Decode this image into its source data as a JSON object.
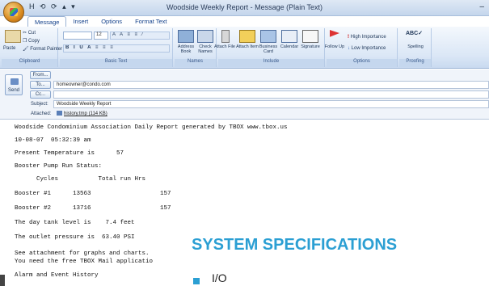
{
  "window": {
    "qat": "H ⟲ ⟳ ▴ ▾",
    "title": "Woodside Weekly Report - Message (Plain Text)",
    "close": "–"
  },
  "tabs": [
    "Message",
    "Insert",
    "Options",
    "Format Text"
  ],
  "ribbon": {
    "clipboard": {
      "cut": "Cut",
      "copy": "Copy",
      "paste": "Paste",
      "format_painter": "Format Painter",
      "label": "Clipboard"
    },
    "basic_text": {
      "font_size": "12",
      "buttons_row1": "A A  ≡ ≡ ⁄",
      "buttons_row2": "B I U  A  ≡ ≡ ≡",
      "label": "Basic Text"
    },
    "names": {
      "address_book": "Address Book",
      "check_names": "Check Names",
      "label": "Names"
    },
    "include": {
      "attach_file": "Attach File",
      "attach_item": "Attach Item",
      "business_card": "Business Card",
      "calendar": "Calendar",
      "signature": "Signature",
      "label": "Include"
    },
    "options": {
      "follow_up": "Follow Up",
      "high_importance": "High Importance",
      "low_importance": "Low Importance",
      "label": "Options"
    },
    "proofing": {
      "spelling": "Spelling",
      "label": "Proofing"
    }
  },
  "header": {
    "send": "Send",
    "from_label": "From...",
    "to_label": "To...",
    "to_value": "homeowner@condo.com",
    "cc_label": "Cc...",
    "subject_label": "Subject:",
    "subject_value": "Woodside Weekly Report",
    "attached_label": "Attached:",
    "attached_value": "history.tmp (114 KB)"
  },
  "body": [
    "Woodside Condominium Association Daily Report generated by TBOX www.tbox.us",
    "10-08-07  05:32:39 am",
    "Present Temperature is      57",
    "Booster Pump Run Status:",
    "      Cycles           Total run Hrs",
    "Booster #1      13563                   157",
    "Booster #2      13716                   157",
    "The day tank level is    7.4 feet",
    "The outlet pressure is  63.40 PSI",
    "See attachment for graphs and charts.",
    "You need the free TBOX Mail applicatio",
    "Alarm and Event History"
  ],
  "overlay": {
    "title": "SYSTEM SPECIFICATIONS",
    "bullet": "I/O"
  },
  "colors": {
    "accent": "#2b9fd3",
    "ribbon": "#dbe7f6"
  }
}
